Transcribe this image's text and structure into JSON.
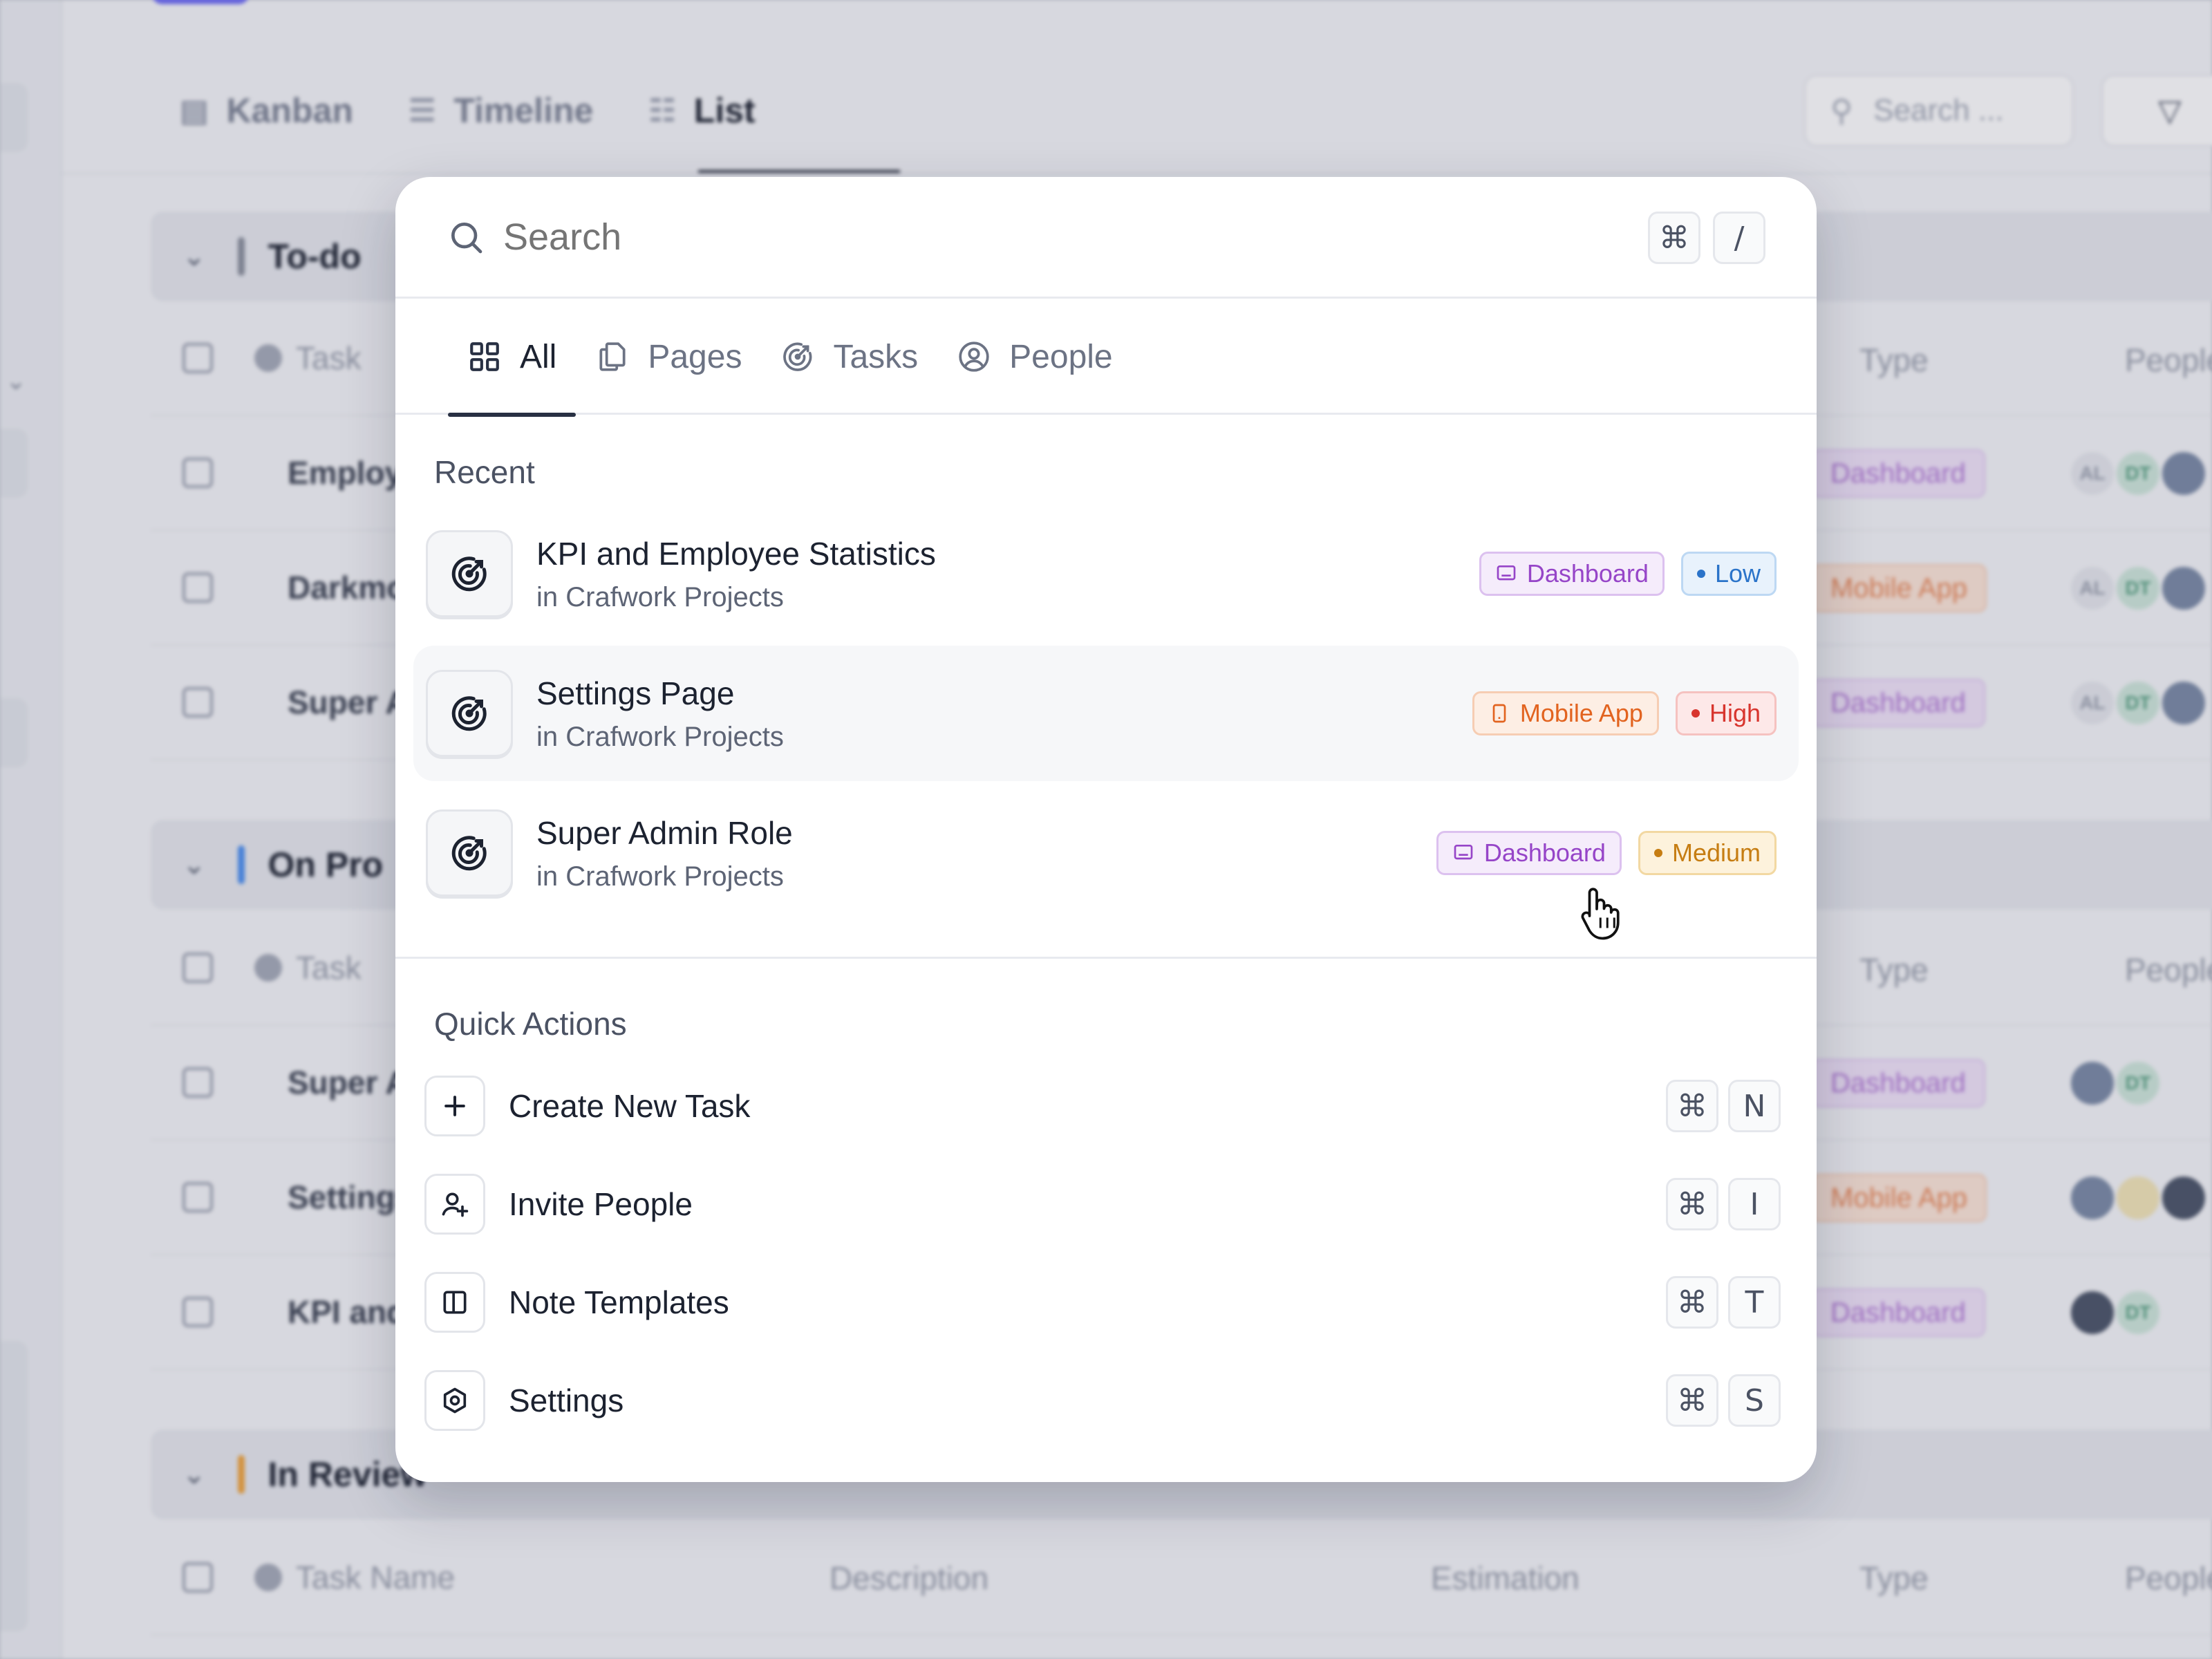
{
  "background": {
    "tabs": [
      "Kanban",
      "Timeline",
      "List"
    ],
    "active_tab": "List",
    "search_placeholder": "Search ...",
    "sections": [
      {
        "title": "To-do",
        "color": "#8a8f9c"
      },
      {
        "title": "On Pro",
        "color": "#4b8ff0"
      },
      {
        "title": "In Review",
        "color": "#f0a43c"
      }
    ],
    "columns": {
      "task": "Task",
      "task_name": "Task Name",
      "description": "Description",
      "estimation": "Estimation",
      "type": "Type",
      "people": "People"
    },
    "rows": [
      "Employ",
      "Darkmo",
      "Super A",
      "Super A",
      "Settings",
      "KPI and"
    ],
    "row_tags": [
      "Dashboard",
      "Mobile App",
      "Dashboard",
      "Dashboard",
      "Mobile App",
      "Dashboard"
    ],
    "avatar_initials": {
      "al": "AL",
      "dt": "DT"
    }
  },
  "search": {
    "placeholder": "Search",
    "shortcut_keys": [
      "⌘",
      "/"
    ]
  },
  "tabs": [
    {
      "label": "All",
      "icon": "grid-icon",
      "active": true
    },
    {
      "label": "Pages",
      "icon": "pages-icon",
      "active": false
    },
    {
      "label": "Tasks",
      "icon": "target-icon",
      "active": false
    },
    {
      "label": "People",
      "icon": "user-circle-icon",
      "active": false
    }
  ],
  "recent": {
    "label": "Recent",
    "items": [
      {
        "title": "KPI and Employee Statistics",
        "subtitle": "in Crafwork Projects",
        "type": "Dashboard",
        "priority": "Low"
      },
      {
        "title": "Settings Page",
        "subtitle": "in Crafwork Projects",
        "type": "Mobile App",
        "priority": "High"
      },
      {
        "title": "Super Admin Role",
        "subtitle": "in Crafwork Projects",
        "type": "Dashboard",
        "priority": "Medium"
      }
    ]
  },
  "quick_actions": {
    "label": "Quick Actions",
    "items": [
      {
        "label": "Create New Task",
        "icon": "plus-icon",
        "keys": [
          "⌘",
          "N"
        ]
      },
      {
        "label": "Invite People",
        "icon": "user-plus-icon",
        "keys": [
          "⌘",
          "I"
        ]
      },
      {
        "label": "Note Templates",
        "icon": "template-icon",
        "keys": [
          "⌘",
          "T"
        ]
      },
      {
        "label": "Settings",
        "icon": "settings-icon",
        "keys": [
          "⌘",
          "S"
        ]
      }
    ]
  },
  "colors": {
    "dashboard": "#9645c8",
    "mobile_app": "#e2631f",
    "low": "#2a73c9",
    "high": "#d8352e",
    "medium": "#c67d12"
  }
}
